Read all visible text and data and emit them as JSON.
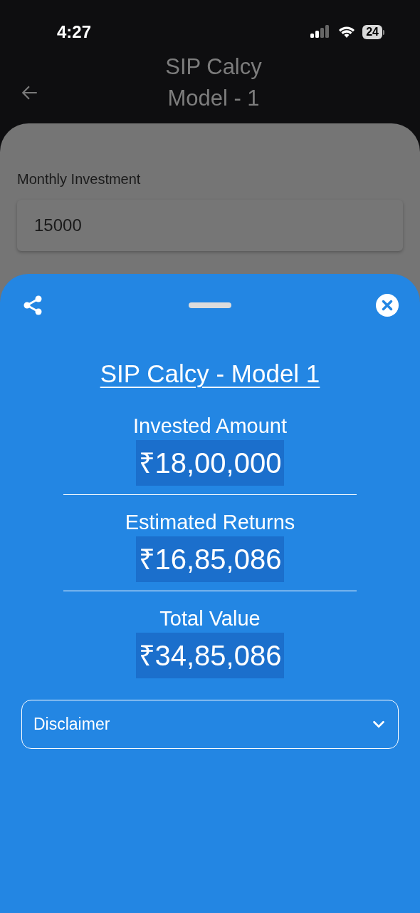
{
  "status_bar": {
    "time": "4:27",
    "battery": "24"
  },
  "header": {
    "title": "SIP Calcy\nModel - 1"
  },
  "form": {
    "label": "Monthly Investment",
    "value": "15000"
  },
  "sheet": {
    "title": "SIP Calcy - Model 1",
    "results": [
      {
        "label": "Invested Amount",
        "value": "₹18,00,000"
      },
      {
        "label": "Estimated Returns",
        "value": "₹16,85,086"
      },
      {
        "label": "Total Value",
        "value": "₹34,85,086"
      }
    ],
    "disclaimer": {
      "label": "Disclaimer",
      "expanded": false
    }
  }
}
